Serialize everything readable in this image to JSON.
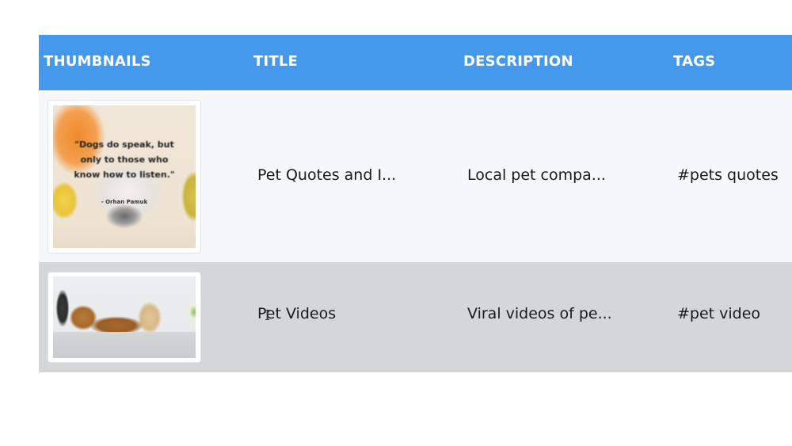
{
  "table": {
    "header_color": "#4499ec",
    "columns": [
      "THUMBNAILS",
      "TITLE",
      "DESCRIPTION",
      "TAGS"
    ],
    "rows": [
      {
        "thumbnail": {
          "alt": "Puppy with pumpkins and quote",
          "quote": "\"Dogs do speak, but only to those who know how to listen.\"",
          "author": "- Orhan Pamuk"
        },
        "title": "Pet Quotes and I...",
        "description": "Local pet compa...",
        "tags": "#pets quotes"
      },
      {
        "thumbnail": {
          "alt": "Two golden retriever puppies on table"
        },
        "title": "Pet Videos",
        "description": "Viral videos of pe...",
        "tags": "#pet video"
      }
    ]
  },
  "cursor": {
    "type": "text-cursor"
  }
}
